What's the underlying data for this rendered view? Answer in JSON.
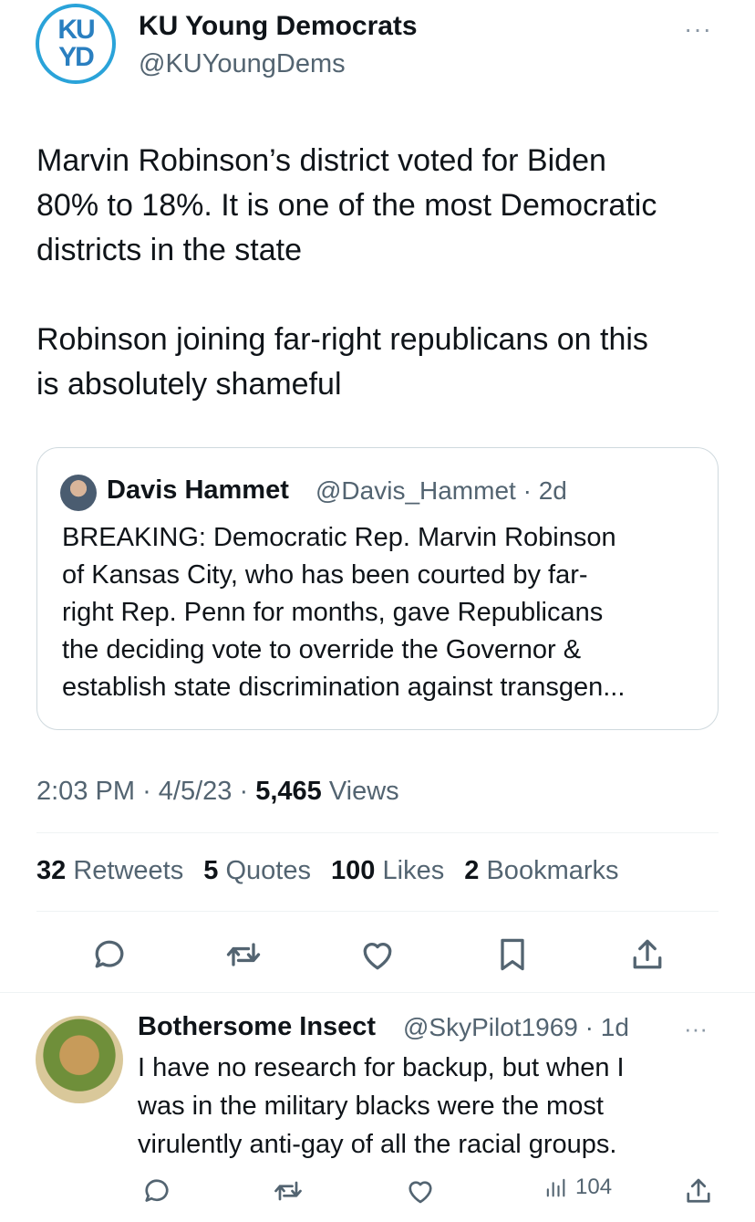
{
  "tweet": {
    "avatar_text_top": "KU",
    "avatar_text_bottom": "YD",
    "display_name": "KU Young Democrats",
    "handle": "@KUYoungDems",
    "more": "···",
    "text": "Marvin Robinson’s district voted for Biden\n80% to 18%. It is one of the most Democratic\ndistricts in the state\n\nRobinson joining far-right republicans on this\nis absolutely shameful",
    "quote": {
      "author_name": "Davis Hammet",
      "author_handle": "@Davis_Hammet",
      "age": "· 2d",
      "text": "BREAKING: Democratic Rep. Marvin Robinson\nof Kansas City, who has been courted by far-\nright Rep. Penn for months, gave Republicans\nthe deciding vote to override the Governor &\nestablish state discrimination against transgen..."
    },
    "time": "2:03 PM",
    "date": "· 4/5/23 ·",
    "views_count": "5,465",
    "views_label": "Views",
    "stats": [
      {
        "count": "32",
        "label": "Retweets"
      },
      {
        "count": "5",
        "label": "Quotes"
      },
      {
        "count": "100",
        "label": "Likes"
      },
      {
        "count": "2",
        "label": "Bookmarks"
      }
    ],
    "actions": [
      "reply-icon",
      "retweet-icon",
      "like-icon",
      "bookmark-icon",
      "share-icon"
    ]
  },
  "reply": {
    "display_name": "Bothersome Insect",
    "handle": "@SkyPilot1969",
    "age": "· 1d",
    "more": "···",
    "text": "I have no research for backup, but when I\nwas in the military blacks were the most\nvirulently anti-gay of all the racial groups.",
    "views": "104"
  },
  "colors": {
    "text": "#0f1419",
    "secondary": "#536471",
    "divider": "#eff3f4",
    "logo_ring": "#2aa3d9"
  }
}
